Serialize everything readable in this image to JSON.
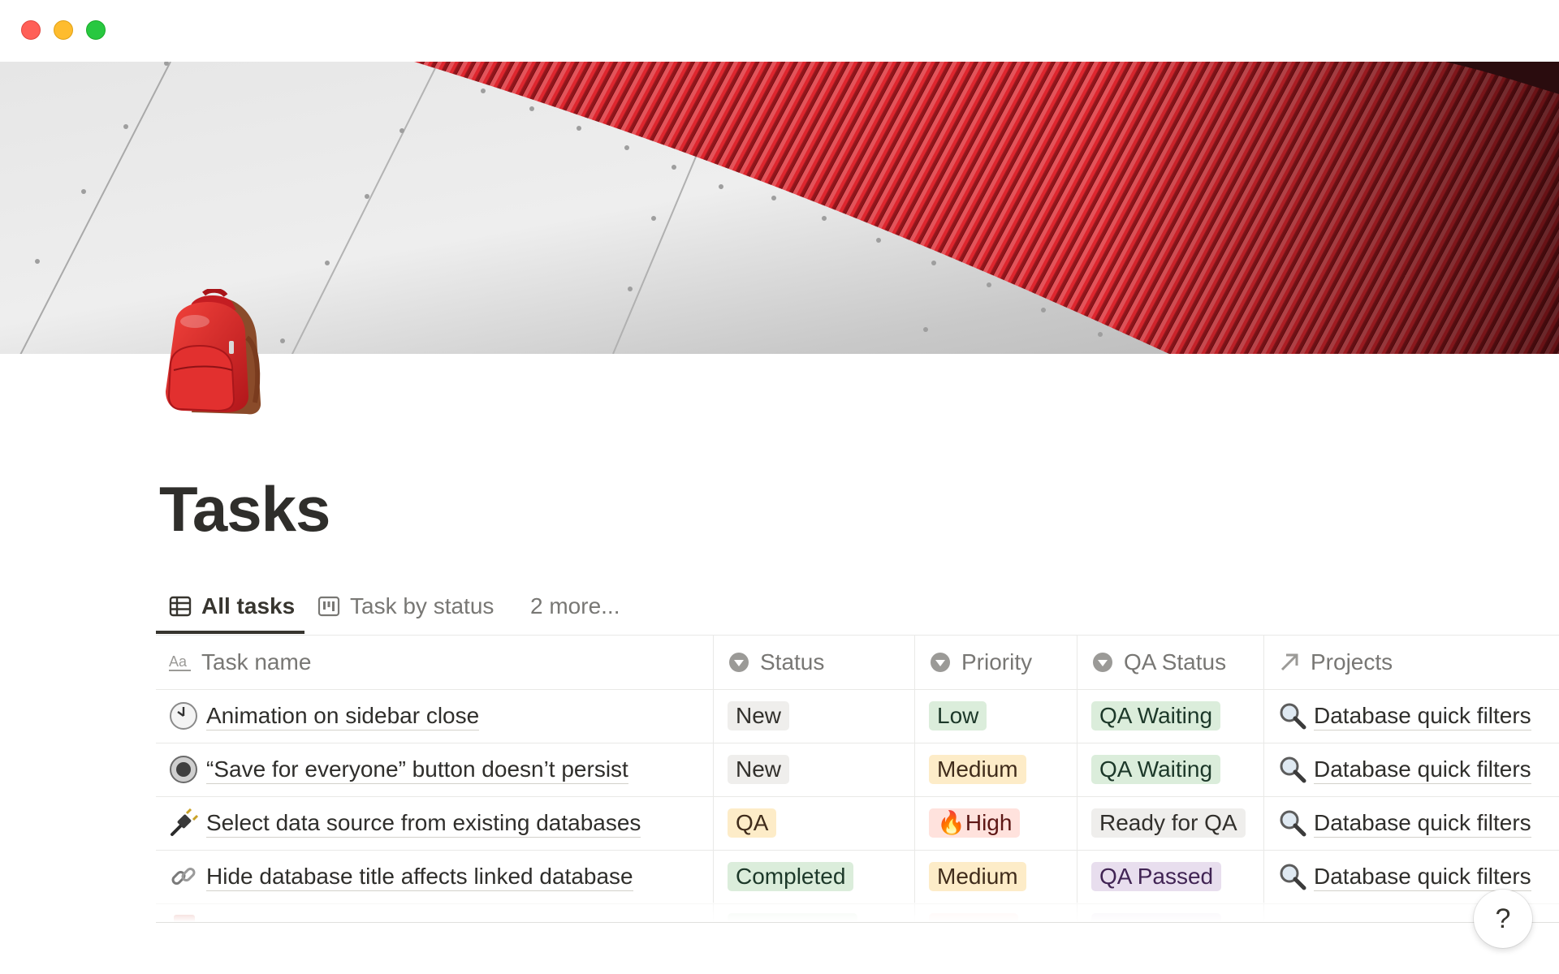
{
  "window": {
    "controls": [
      "close",
      "minimize",
      "zoom"
    ]
  },
  "cover": {
    "description_icon": "cover-image"
  },
  "page": {
    "icon": "backpack-icon",
    "title": "Tasks"
  },
  "tabs": [
    {
      "label": "All tasks",
      "icon": "table-icon",
      "active": true
    },
    {
      "label": "Task by status",
      "icon": "board-icon",
      "active": false
    },
    {
      "label": "2 more...",
      "active": false
    }
  ],
  "table": {
    "columns": [
      {
        "label": "Task name",
        "icon": "text-aa-icon"
      },
      {
        "label": "Status",
        "icon": "select-icon"
      },
      {
        "label": "Priority",
        "icon": "select-icon"
      },
      {
        "label": "QA Status",
        "icon": "select-icon"
      },
      {
        "label": "Projects",
        "icon": "relation-arrow-icon"
      }
    ],
    "rows": [
      {
        "icon": "clock-icon",
        "name": "Animation on sidebar close",
        "status": "New",
        "priority": "Low",
        "qa_status": "QA Waiting",
        "project": "Database quick filters"
      },
      {
        "icon": "radio-button-icon",
        "name": "“Save for everyone” button doesn’t persist",
        "status": "New",
        "priority": "Medium",
        "qa_status": "QA Waiting",
        "project": "Database quick filters"
      },
      {
        "icon": "plug-icon",
        "name": "Select data source from existing databases",
        "status": "QA",
        "priority": "🔥High",
        "qa_status": "Ready for QA",
        "project": "Database quick filters"
      },
      {
        "icon": "link-icon",
        "name": "Hide database title affects linked database",
        "status": "Completed",
        "priority": "Medium",
        "qa_status": "QA Passed",
        "project": "Database quick filters"
      }
    ]
  },
  "colors": {
    "status_new": "#efeeec",
    "status_qa": "#fdecc8",
    "status_completed": "#dbeddb",
    "priority_low": "#dbeddb",
    "priority_medium": "#fdecc8",
    "priority_high": "#ffe2dd",
    "qa_waiting": "#dbeddb",
    "qa_ready": "#efeeec",
    "qa_passed": "#e8deee"
  },
  "help": {
    "label": "?"
  }
}
